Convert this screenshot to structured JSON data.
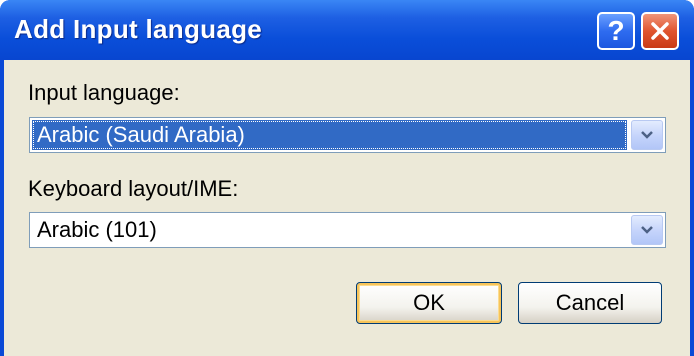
{
  "window": {
    "title": "Add Input language",
    "help_label": "?"
  },
  "input_language": {
    "label": "Input language:",
    "selected_value": "Arabic (Saudi Arabia)"
  },
  "keyboard_layout": {
    "label": "Keyboard layout/IME:",
    "selected_value": "Arabic (101)"
  },
  "buttons": {
    "ok_label": "OK",
    "cancel_label": "Cancel"
  },
  "colors": {
    "titlebar": "#0a4ed9",
    "selection": "#316ac5",
    "dialog_face": "#ece9d8",
    "close_button": "#e0552f"
  }
}
